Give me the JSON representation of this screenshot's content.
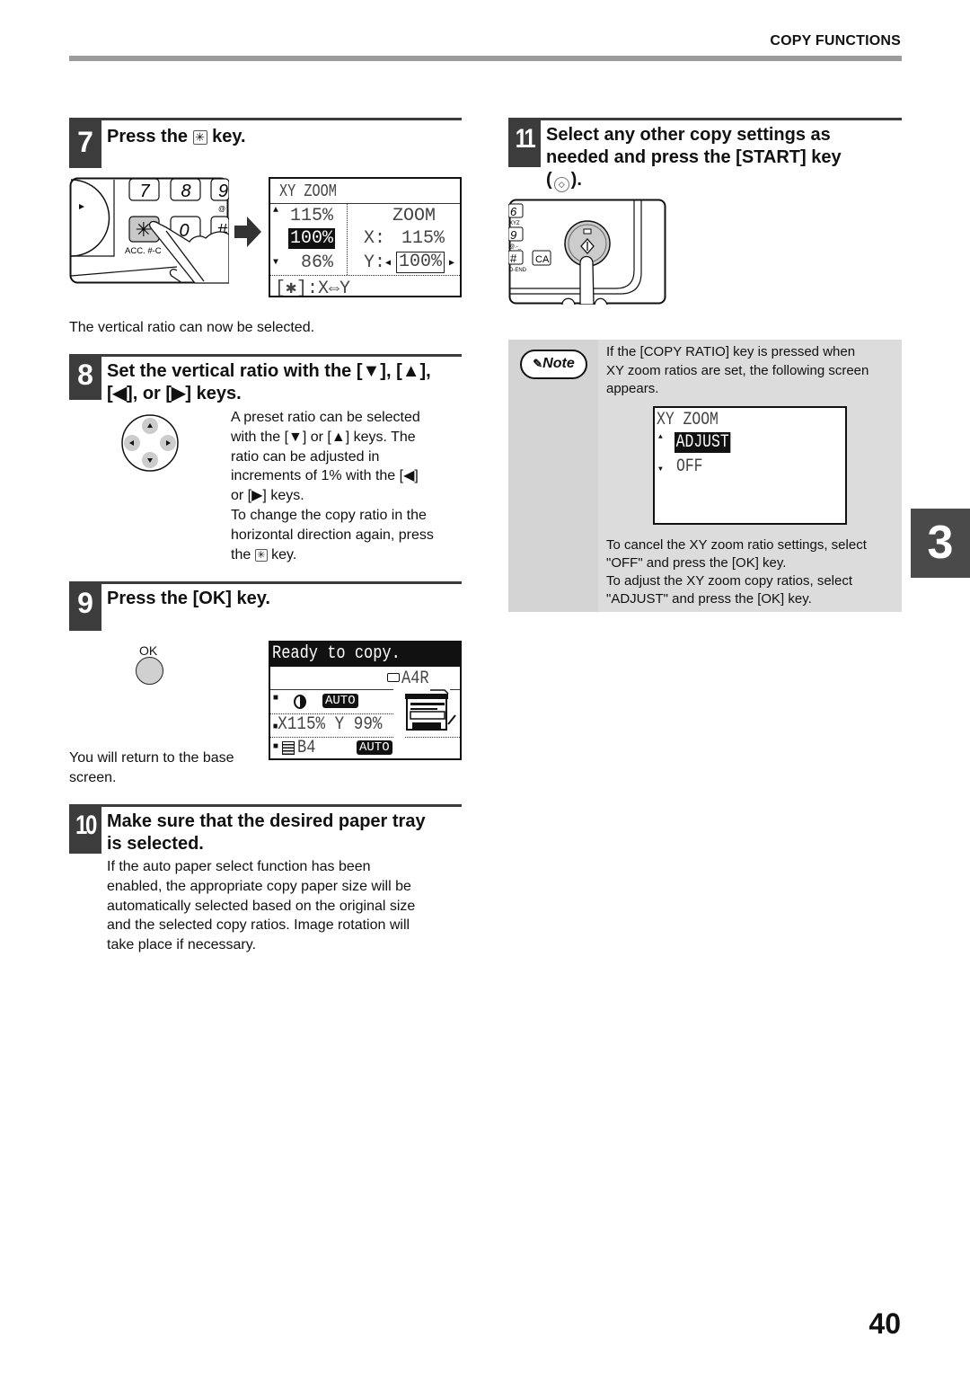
{
  "header": {
    "section_title": "COPY FUNCTIONS"
  },
  "chapter_tab": "3",
  "page_number": "40",
  "steps": {
    "s7": {
      "number": "7",
      "title_pre": "Press the ",
      "title_key": "✳",
      "title_post": " key.",
      "keypad": {
        "keys": [
          "7",
          "8",
          "9",
          "✳",
          "0",
          "#"
        ],
        "key_sub": "ACC. #-C",
        "at_label": "@"
      },
      "lcd": {
        "title": "XY ZOOM",
        "list": [
          "115%",
          "100%",
          "86%"
        ],
        "selected_index": 1,
        "zoom_label": "ZOOM",
        "x_label": "X:",
        "x_value": "115%",
        "y_label": "Y:",
        "y_value": "100%",
        "footer_key": "[✱]",
        "footer_text": ":X⇔Y"
      },
      "caption": "The vertical ratio can now be selected."
    },
    "s8": {
      "number": "8",
      "title_line1": "Set the vertical ratio with the [▼], [▲],",
      "title_line2": "[◀], or [▶] keys.",
      "body_lines": [
        "A preset ratio can be selected",
        "with the [▼] or [▲] keys. The",
        "ratio can be adjusted in",
        "increments of 1% with the [◀]",
        "or [▶] keys.",
        "To change the copy ratio in the",
        "horizontal direction again, press"
      ],
      "body_last_pre": "the ",
      "body_last_key": "✳",
      "body_last_post": " key."
    },
    "s9": {
      "number": "9",
      "title": "Press the [OK] key.",
      "ok_label": "OK",
      "lcd": {
        "status": "Ready to copy.",
        "paper": "A4R",
        "exposure_badge": "AUTO",
        "ratio": "X115% Y 99%",
        "tray": "B4",
        "tray_badge": "AUTO"
      },
      "caption_line1": "You will return to the base",
      "caption_line2": "screen."
    },
    "s10": {
      "number": "10",
      "title_line1": "Make sure that the desired paper tray",
      "title_line2": "is selected.",
      "body_lines": [
        "If the auto paper select function has been",
        "enabled, the appropriate copy paper size will be",
        "automatically selected based on the original size",
        "and the selected copy ratios. Image rotation will",
        "take place if necessary."
      ]
    },
    "s11": {
      "number": "11",
      "title_line1": "Select any other copy settings as",
      "title_line2": "needed and press the [START] key",
      "title_line3_pre": "(",
      "title_line3_post": ").",
      "panel": {
        "keys": [
          "6",
          "9",
          "#"
        ],
        "ca": "CA",
        "sub1": "XYZ",
        "sub2": "@.-_",
        "sub3": "D-END"
      }
    }
  },
  "note": {
    "badge": "Note",
    "intro_lines": [
      "If the [COPY RATIO] key is pressed when",
      "XY zoom ratios are set, the following screen",
      "appears."
    ],
    "lcd": {
      "title": "XY ZOOM",
      "options": [
        "ADJUST",
        "OFF"
      ],
      "selected_index": 0
    },
    "after_lines": [
      "To cancel the XY zoom ratio settings, select",
      "\"OFF\" and press the [OK] key.",
      "To adjust the XY zoom copy ratios, select",
      "\"ADJUST\" and press the [OK] key."
    ]
  }
}
